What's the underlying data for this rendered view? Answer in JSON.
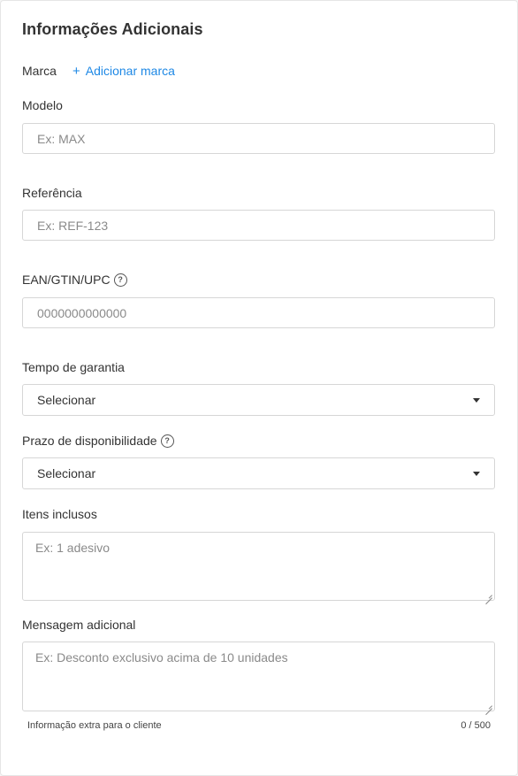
{
  "section": {
    "title": "Informações Adicionais"
  },
  "marca": {
    "label": "Marca",
    "add_label": "Adicionar marca",
    "plus": "+"
  },
  "modelo": {
    "label": "Modelo",
    "placeholder": "Ex: MAX"
  },
  "referencia": {
    "label": "Referência",
    "placeholder": "Ex: REF-123"
  },
  "ean": {
    "label": "EAN/GTIN/UPC",
    "placeholder": "0000000000000",
    "help": "?"
  },
  "garantia": {
    "label": "Tempo de garantia",
    "value": "Selecionar"
  },
  "disponibilidade": {
    "label": "Prazo de disponibilidade",
    "value": "Selecionar",
    "help": "?"
  },
  "itens": {
    "label": "Itens inclusos",
    "placeholder": "Ex: 1 adesivo"
  },
  "mensagem": {
    "label": "Mensagem adicional",
    "placeholder": "Ex: Desconto exclusivo acima de 10 unidades",
    "hint": "Informação extra para o cliente",
    "counter": "0 / 500"
  }
}
